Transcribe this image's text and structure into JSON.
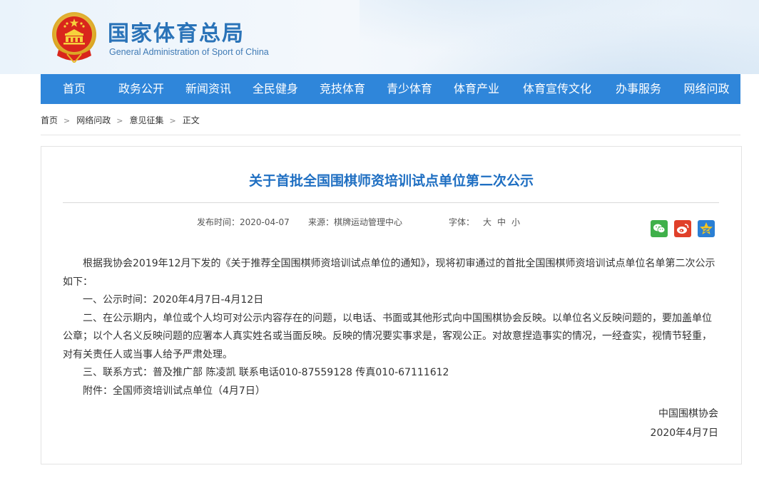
{
  "site": {
    "title": "国家体育总局",
    "subtitle": "General Administration of Sport of China"
  },
  "nav": {
    "items": [
      {
        "label": "首页",
        "name": "nav-item-home"
      },
      {
        "label": "政务公开",
        "name": "nav-item-government-affairs"
      },
      {
        "label": "新闻资讯",
        "name": "nav-item-news"
      },
      {
        "label": "全民健身",
        "name": "nav-item-fitness"
      },
      {
        "label": "竞技体育",
        "name": "nav-item-competitive-sports"
      },
      {
        "label": "青少体育",
        "name": "nav-item-youth-sports"
      },
      {
        "label": "体育产业",
        "name": "nav-item-sports-industry"
      },
      {
        "label": "体育宣传文化",
        "name": "nav-item-sports-culture"
      },
      {
        "label": "办事服务",
        "name": "nav-item-services"
      },
      {
        "label": "网络问政",
        "name": "nav-item-online-inquiry"
      }
    ]
  },
  "breadcrumb": [
    "首页",
    "网络问政",
    "意见征集",
    "正文"
  ],
  "article": {
    "title": "关于首批全国围棋师资培训试点单位第二次公示",
    "publish_label": "发布时间：",
    "publish_date": "2020-04-07",
    "source_label": "来源：",
    "source": "棋牌运动管理中心",
    "font_label": "字体：",
    "font_sizes": [
      "大",
      "中",
      "小"
    ],
    "share": [
      {
        "name": "wechat-share-icon",
        "color": "#3fb04a"
      },
      {
        "name": "weibo-share-icon",
        "color": "#e0402a"
      },
      {
        "name": "qzone-share-icon",
        "color": "#2a7fd4"
      }
    ],
    "paragraphs": [
      "根据我协会2019年12月下发的《关于推荐全国围棋师资培训试点单位的通知》，现将初审通过的首批全国围棋师资培训试点单位名单第二次公示如下：",
      "一、公示时间：2020年4月7日-4月12日",
      "二、在公示期内，单位或个人均可对公示内容存在的问题，以电话、书面或其他形式向中国围棋协会反映。以单位名义反映问题的，要加盖单位公章；以个人名义反映问题的应署本人真实姓名或当面反映。反映的情况要实事求是，客观公正。对故意捏造事实的情况，一经查实，视情节轻重，对有关责任人或当事人给予严肃处理。",
      "三、联系方式：普及推广部  陈凌凯   联系电话010-87559128  传真010-67111612"
    ],
    "attachment_label": "附件：",
    "attachment_link": "全国师资培训试点单位（4月7日）",
    "signature_org": "中国围棋协会",
    "signature_date": "2020年4月7日"
  },
  "colors": {
    "nav_bg": "#2f86da",
    "title_blue": "#1f6fc2",
    "emblem_red": "#d9261c",
    "emblem_gold": "#e8b625"
  }
}
